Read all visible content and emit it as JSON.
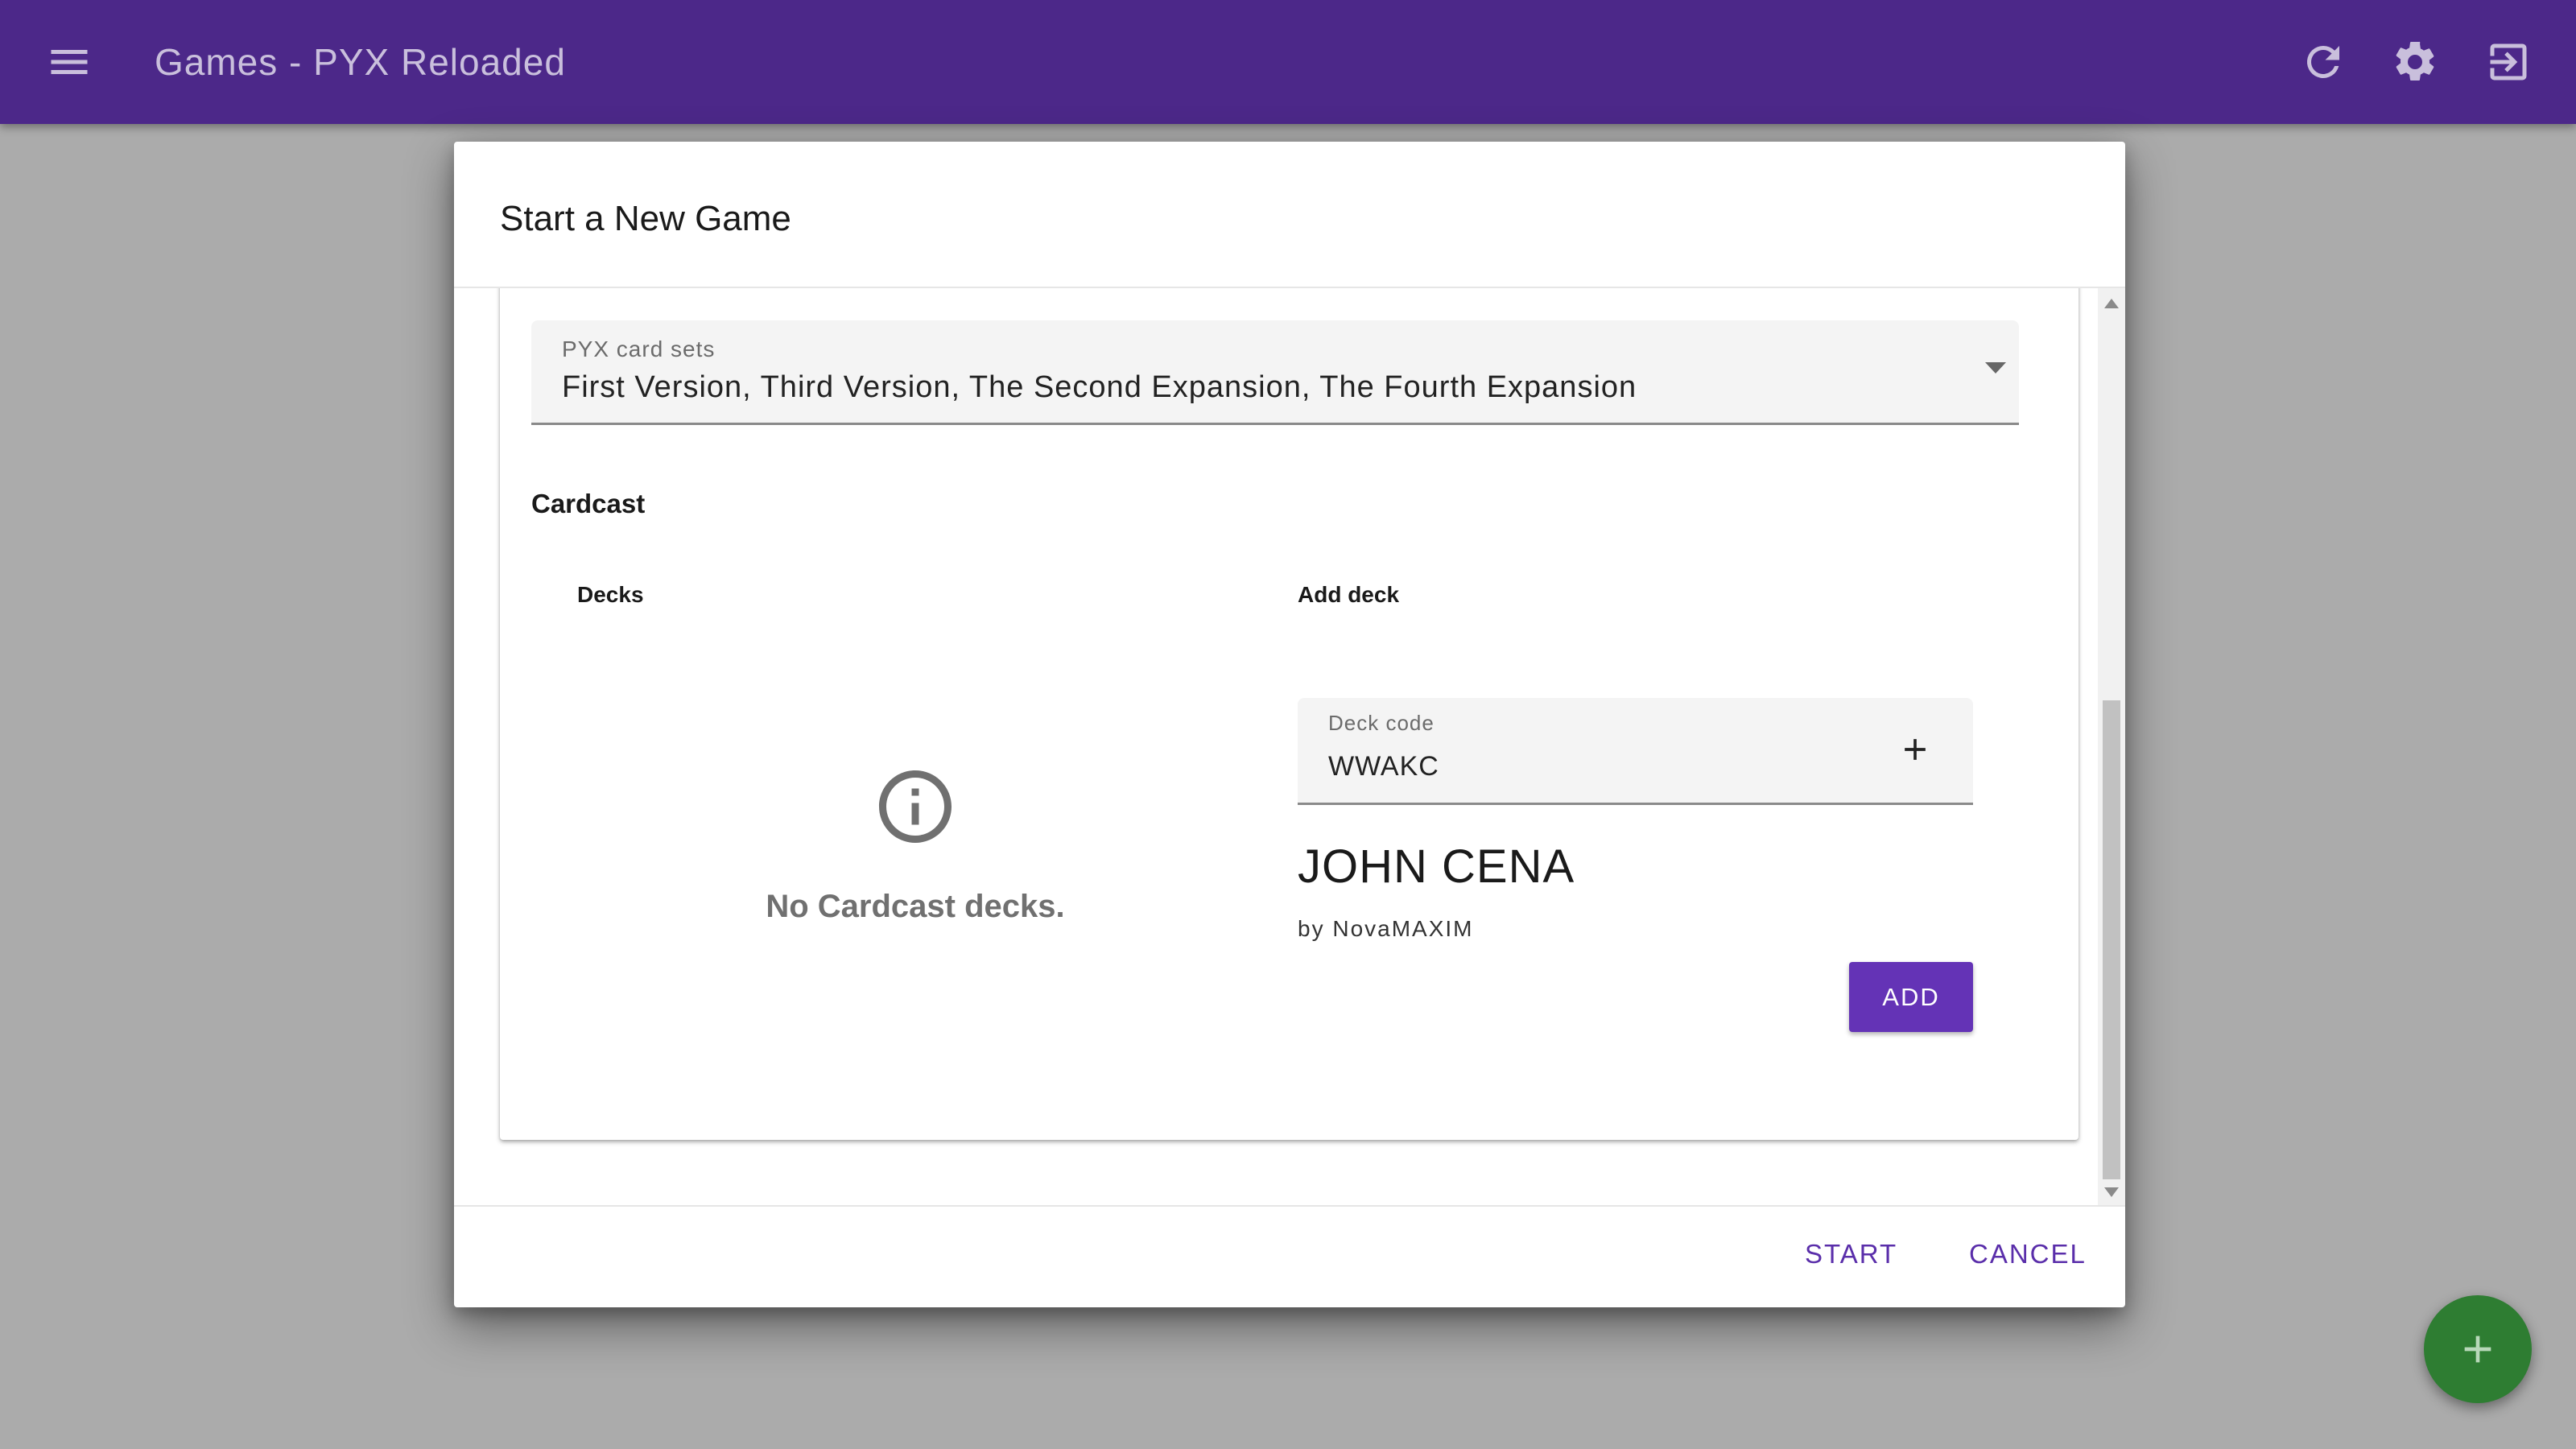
{
  "appbar": {
    "title": "Games - PYX Reloaded",
    "icons": {
      "menu": "menu-icon",
      "refresh": "refresh-icon",
      "settings": "gear-icon",
      "logout": "exit-icon"
    },
    "color": "#4c2889"
  },
  "dialog": {
    "title": "Start a New Game",
    "pyx": {
      "label": "PYX card sets",
      "value": "First Version, Third Version, The Second Expansion, The Fourth Expansion"
    },
    "cardcast": {
      "title": "Cardcast",
      "decks_title": "Decks",
      "add_title": "Add deck",
      "empty_text": "No Cardcast decks.",
      "deck_code": {
        "label": "Deck code",
        "value": "WWAKC"
      },
      "preview": {
        "name": "JOHN CENA",
        "author": "by NovaMAXIM"
      },
      "add_button": "ADD"
    },
    "actions": {
      "start": "START",
      "cancel": "CANCEL"
    }
  },
  "fab": {
    "icon": "plus-icon",
    "color": "#2e7d32"
  },
  "colors": {
    "primary": "#6433b6",
    "overlay": "#ababab"
  }
}
